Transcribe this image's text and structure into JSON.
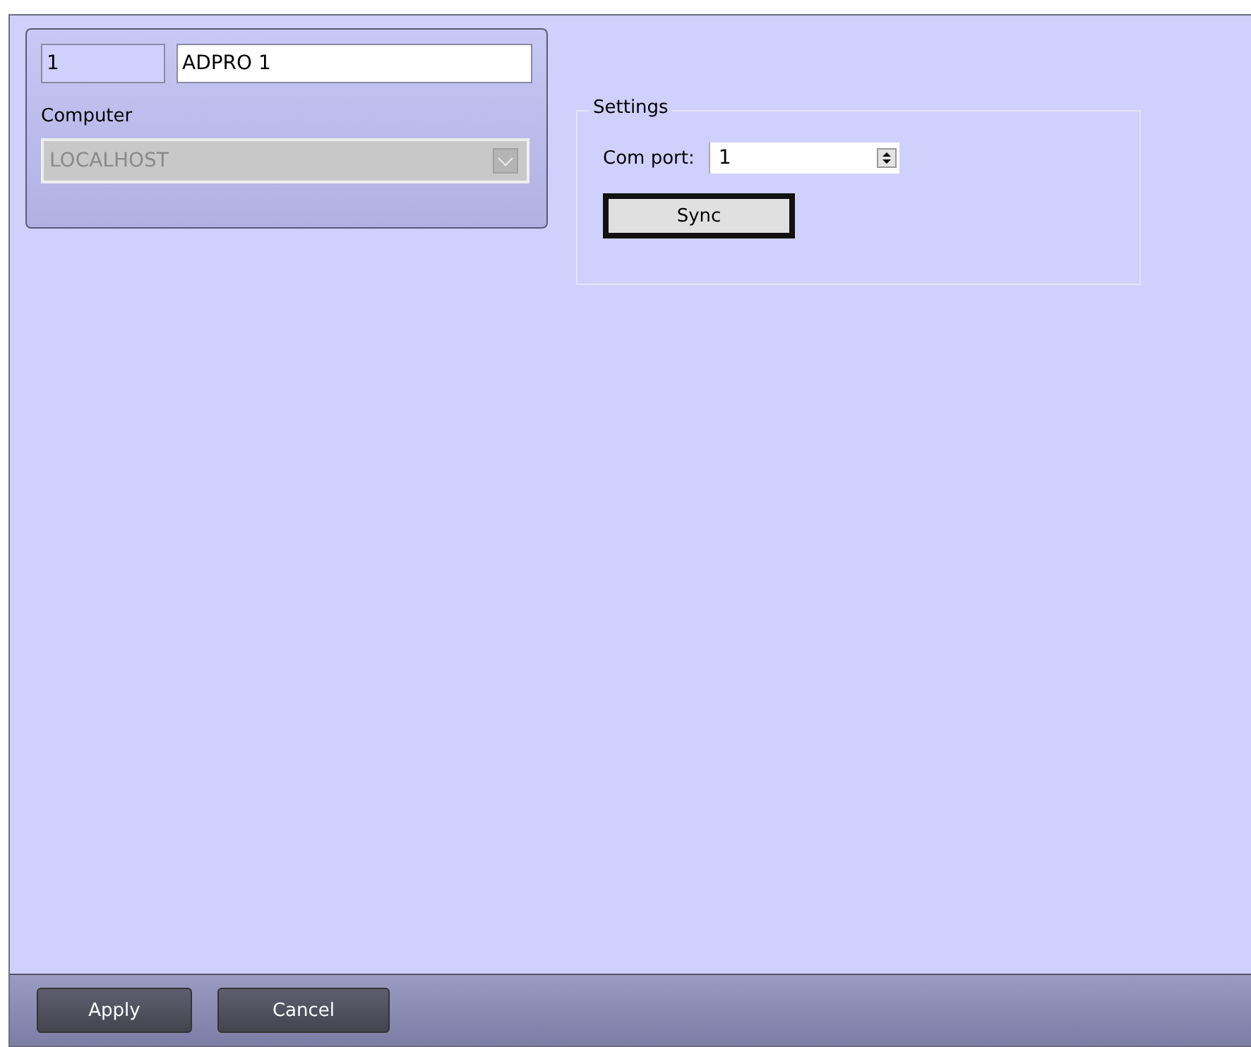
{
  "object_card": {
    "number": "1",
    "name": "ADPRO 1",
    "computer_label": "Computer",
    "computer": {
      "value": "LOCALHOST",
      "disabled": true
    }
  },
  "settings": {
    "title": "Settings",
    "com_port_label": "Com port:",
    "com_port": "1",
    "sync_button": {
      "label": "Sync",
      "focused": true
    }
  },
  "buttons": [
    {
      "label": "Apply"
    },
    {
      "label": "Cancel"
    }
  ]
}
